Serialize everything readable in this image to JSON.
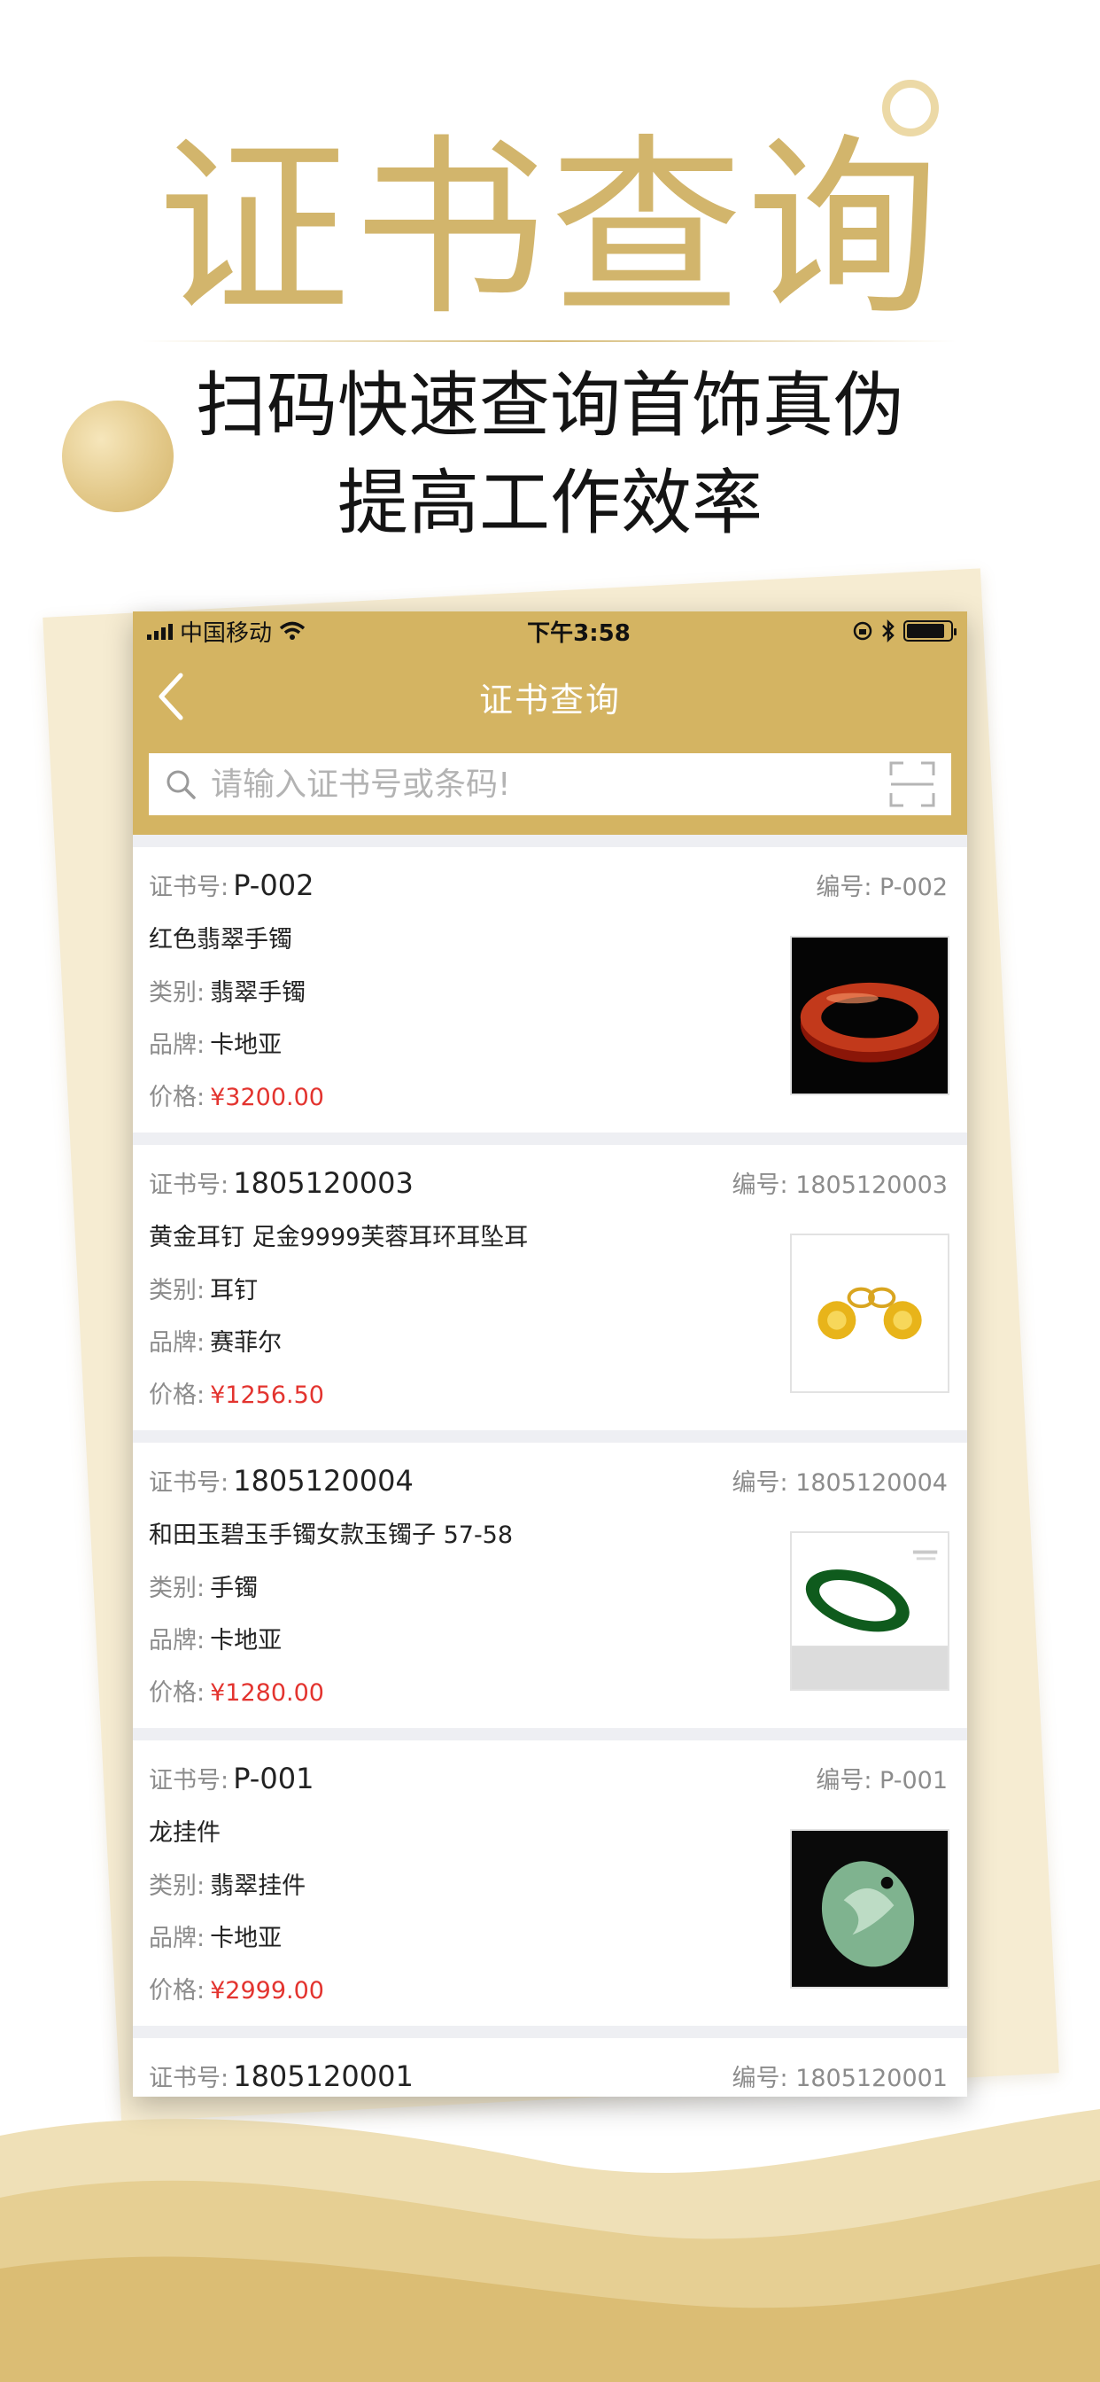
{
  "promo": {
    "title": "证书查询",
    "tagline_line1": "扫码快速查询首饰真伪",
    "tagline_line2": "提高工作效率"
  },
  "status_bar": {
    "carrier": "中国移动",
    "time": "下午3:58"
  },
  "nav": {
    "title": "证书查询",
    "back_icon": "chevron-left-icon"
  },
  "search": {
    "placeholder": "请输入证书号或条码!",
    "value": "",
    "search_icon": "search-icon",
    "scan_icon": "scan-icon"
  },
  "labels": {
    "cert": "证书号:",
    "code": "编号:",
    "category": "类别:",
    "brand": "品牌:",
    "price": "价格:"
  },
  "items": [
    {
      "cert_no": "P-002",
      "code": "P-002",
      "name": "红色翡翠手镯",
      "category": "翡翠手镯",
      "brand": "卡地亚",
      "price": "¥3200.00",
      "image": "red-jade-bangle"
    },
    {
      "cert_no": "1805120003",
      "code": "1805120003",
      "name": "黄金耳钉 足金9999芙蓉耳环耳坠耳",
      "category": "耳钉",
      "brand": "赛菲尔",
      "price": "¥1256.50",
      "image": "gold-flower-earrings"
    },
    {
      "cert_no": "1805120004",
      "code": "1805120004",
      "name": "和田玉碧玉手镯女款玉镯子 57-58",
      "category": "手镯",
      "brand": "卡地亚",
      "price": "¥1280.00",
      "image": "green-jade-bangle"
    },
    {
      "cert_no": "P-001",
      "code": "P-001",
      "name": "龙挂件",
      "category": "翡翠挂件",
      "brand": "卡地亚",
      "price": "¥2999.00",
      "image": "jade-dragon-pendant"
    },
    {
      "cert_no": "1805120001",
      "code": "1805120001"
    }
  ],
  "colors": {
    "accent": "#d4b462",
    "title_gold": "#d2b56c",
    "price_red": "#e3342f",
    "background_gray": "#eeeff3"
  }
}
